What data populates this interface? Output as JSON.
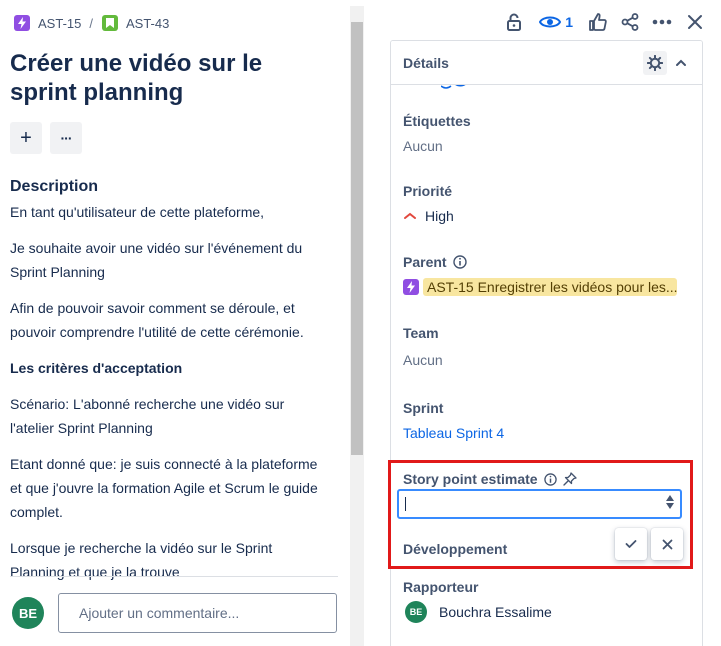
{
  "breadcrumb": {
    "parent_key": "AST-15",
    "separator": "/",
    "issue_key": "AST-43"
  },
  "issue": {
    "title": "Créer une vidéo sur le sprint planning"
  },
  "toolbar": {
    "add_label": "+",
    "more_label": "···"
  },
  "description": {
    "heading": "Description",
    "paragraphs": [
      "En tant qu'utilisateur de cette plateforme,",
      "Je souhaite avoir une vidéo sur l'événement du Sprint Planning",
      "Afin de pouvoir savoir comment se déroule, et pouvoir comprendre l'utilité de cette cérémonie.",
      "Les critères d'acceptation",
      "Scénario: L'abonné recherche une vidéo sur l'atelier Sprint Planning",
      "Etant donné que: je suis connecté à la plateforme et que j'ouvre la formation Agile et Scrum le guide complet.",
      "Lorsque je recherche la vidéo sur le Sprint Planning et que je la trouve"
    ]
  },
  "comment": {
    "avatar_initials": "BE",
    "placeholder": "Ajouter un commentaire..."
  },
  "actions": {
    "watch_count": "1"
  },
  "details": {
    "title": "Détails",
    "labels": {
      "label": "Étiquettes",
      "value": "Aucun"
    },
    "priority": {
      "label": "Priorité",
      "value": "High"
    },
    "parent": {
      "label": "Parent",
      "value": "AST-15 Enregistrer les vidéos pour les..."
    },
    "team": {
      "label": "Team",
      "value": "Aucun"
    },
    "sprint": {
      "label": "Sprint",
      "value": "Tableau Sprint 4"
    },
    "story_points": {
      "label": "Story point estimate",
      "value": ""
    },
    "development": {
      "label": "Développement"
    },
    "reporter": {
      "label": "Rapporteur",
      "initials": "BE",
      "name": "Bouchra Essalime"
    }
  },
  "colors": {
    "accent": "#0c66e4",
    "epic": "#904ee2",
    "story": "#63ba3c",
    "priority_high": "#e2483d",
    "avatar": "#1f845a",
    "highlight": "#e11919",
    "parent_lozenge": "#f8e6a0"
  }
}
